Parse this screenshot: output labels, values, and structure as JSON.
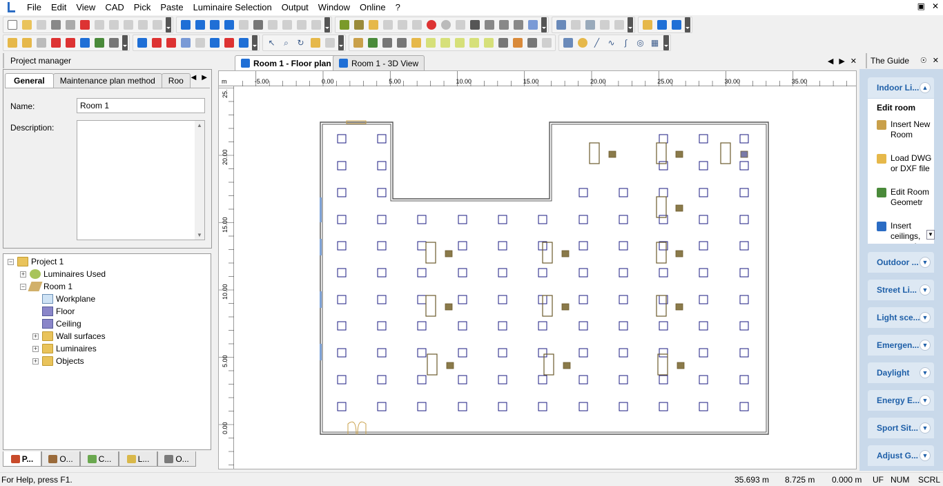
{
  "menu": [
    "File",
    "Edit",
    "View",
    "CAD",
    "Pick",
    "Paste",
    "Luminaire Selection",
    "Output",
    "Window",
    "Online",
    "?"
  ],
  "project_manager": {
    "title": "Project manager",
    "tabs": [
      "General",
      "Maintenance plan method",
      "Roo"
    ],
    "name_label": "Name:",
    "name_value": "Room 1",
    "description_label": "Description:",
    "description_value": ""
  },
  "tree": [
    {
      "label": "Project 1",
      "icon": "folder-icon",
      "level": 0,
      "expander": "−"
    },
    {
      "label": "Luminaires Used",
      "icon": "luminaire-icon",
      "level": 1,
      "expander": "+"
    },
    {
      "label": "Room 1",
      "icon": "room-icon",
      "level": 1,
      "expander": "−"
    },
    {
      "label": "Workplane",
      "icon": "workplane-icon",
      "level": 2,
      "expander": ""
    },
    {
      "label": "Floor",
      "icon": "floor-icon",
      "level": 2,
      "expander": ""
    },
    {
      "label": "Ceiling",
      "icon": "ceiling-icon",
      "level": 2,
      "expander": ""
    },
    {
      "label": "Wall surfaces",
      "icon": "folder-icon",
      "level": 2,
      "expander": "+"
    },
    {
      "label": "Luminaires",
      "icon": "folder-icon",
      "level": 2,
      "expander": "+"
    },
    {
      "label": "Objects",
      "icon": "folder-icon",
      "level": 2,
      "expander": "+"
    }
  ],
  "bottom_tabs": [
    {
      "label": "P...",
      "icon": "project-icon",
      "color": "#c84a2a"
    },
    {
      "label": "O...",
      "icon": "objects-icon",
      "color": "#9a6a3a"
    },
    {
      "label": "C...",
      "icon": "colors-icon",
      "color": "#6aa84f"
    },
    {
      "label": "L...",
      "icon": "luminaires-icon",
      "color": "#d9b84a"
    },
    {
      "label": "O...",
      "icon": "output-icon",
      "color": "#7a7a7a"
    }
  ],
  "doc_tabs": [
    {
      "label": "Room 1 - Floor plan",
      "active": true
    },
    {
      "label": "Room 1 - 3D View",
      "active": false
    }
  ],
  "ruler": {
    "units": "m",
    "x_labels": [
      {
        "text": "-5.00",
        "value": -5
      },
      {
        "text": "0.00",
        "value": 0
      },
      {
        "text": "5.00",
        "value": 5
      },
      {
        "text": "10.00",
        "value": 10
      },
      {
        "text": "15.00",
        "value": 15
      },
      {
        "text": "20.00",
        "value": 20
      },
      {
        "text": "25.00",
        "value": 25
      },
      {
        "text": "30.00",
        "value": 30
      },
      {
        "text": "35.00",
        "value": 35
      }
    ],
    "y_labels": [
      {
        "text": "25.",
        "value": 25
      },
      {
        "text": "20.00",
        "value": 20
      },
      {
        "text": "15.00",
        "value": 15
      },
      {
        "text": "10.00",
        "value": 10
      },
      {
        "text": "5.00",
        "value": 5
      },
      {
        "text": "0.00",
        "value": 0
      }
    ]
  },
  "guide": {
    "title": "The Guide",
    "sections": [
      "Indoor Li...",
      "Outdoor ...",
      "Street Li...",
      "Light sce...",
      "Emergen...",
      "Daylight",
      "Energy E...",
      "Sport Sit...",
      "Adjust G..."
    ],
    "edit_room": {
      "heading": "Edit room",
      "items": [
        {
          "label": "Insert New Room",
          "icon": "insert-room-icon",
          "color": "#c9a04a"
        },
        {
          "label": "Load DWG or DXF file",
          "icon": "load-dxf-icon",
          "color": "#e6b84a"
        },
        {
          "label": "Edit Room Geometr",
          "icon": "edit-geometry-icon",
          "color": "#4a8a3a"
        },
        {
          "label": "Insert ceilings, ground",
          "icon": "insert-ceiling-icon",
          "color": "#2b6cc4"
        }
      ]
    }
  },
  "status": {
    "help": "For Help, press F1.",
    "x": "35.693 m",
    "y": "8.725 m",
    "z": "0.000 m",
    "uf": "UF",
    "num": "NUM",
    "scrl": "SCRL"
  },
  "colors": {
    "luminaire": "#1a1a80",
    "wall": "#555555",
    "furniture": "#6b5a2b",
    "accent": "#1e5fa8"
  }
}
